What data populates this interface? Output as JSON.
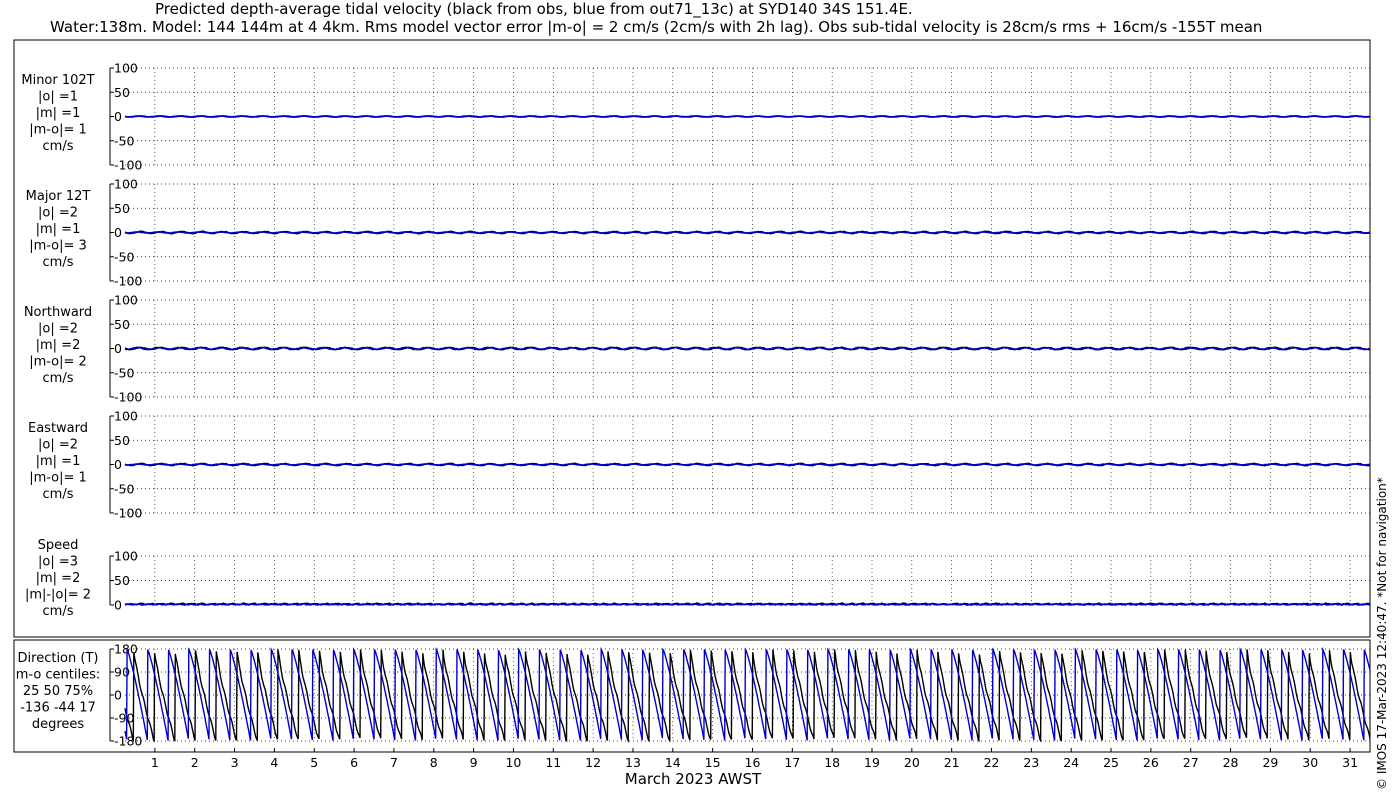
{
  "title_line1": "Predicted depth-average tidal velocity (black from obs, blue from out71_13c) at SYD140 34S 151.4E.",
  "title_line2": "Water:138m. Model: 144 144m at 4 4km. Rms model vector error |m-o| = 2 cm/s (2cm/s with 2h lag). Obs sub-tidal velocity is 28cm/s rms + 16cm/s -155T mean",
  "copyright": "© IMOS 17-Mar-2023 12:40:47. *Not for navigation*",
  "xaxis_label": "March 2023 AWST",
  "colors": {
    "obs": "#000000",
    "model": "#0000cc",
    "grid": "#000000"
  },
  "chart_data": [
    {
      "type": "line",
      "name": "minor",
      "panel_label": [
        "Minor 102T",
        "|o| =1",
        "|m| =1",
        "|m-o|= 1",
        "cm/s"
      ],
      "y_ticks": [
        "100",
        "50",
        "0",
        "-50",
        "-100"
      ],
      "ylim": [
        -100,
        100
      ],
      "series": [
        {
          "name": "obs",
          "amplitude": 1,
          "mean": 0
        },
        {
          "name": "model",
          "amplitude": 1,
          "mean": 0
        }
      ]
    },
    {
      "type": "line",
      "name": "major",
      "panel_label": [
        "Major 12T",
        "|o| =2",
        "|m| =1",
        "|m-o|= 3",
        "cm/s"
      ],
      "y_ticks": [
        "100",
        "50",
        "0",
        "-50",
        "-100"
      ],
      "ylim": [
        -100,
        100
      ],
      "series": [
        {
          "name": "obs",
          "amplitude": 2,
          "mean": 0
        },
        {
          "name": "model",
          "amplitude": 1,
          "mean": 0
        }
      ]
    },
    {
      "type": "line",
      "name": "northward",
      "panel_label": [
        "Northward",
        "|o| =2",
        "|m| =2",
        "|m-o|= 2",
        "cm/s"
      ],
      "y_ticks": [
        "100",
        "50",
        "0",
        "-50",
        "-100"
      ],
      "ylim": [
        -100,
        100
      ],
      "series": [
        {
          "name": "obs",
          "amplitude": 2,
          "mean": 0
        },
        {
          "name": "model",
          "amplitude": 2,
          "mean": 0
        }
      ]
    },
    {
      "type": "line",
      "name": "eastward",
      "panel_label": [
        "Eastward",
        "|o| =2",
        "|m| =1",
        "|m-o|= 1",
        "cm/s"
      ],
      "y_ticks": [
        "100",
        "50",
        "0",
        "-50",
        "-100"
      ],
      "ylim": [
        -100,
        100
      ],
      "series": [
        {
          "name": "obs",
          "amplitude": 2,
          "mean": 0
        },
        {
          "name": "model",
          "amplitude": 1,
          "mean": 0
        }
      ]
    },
    {
      "type": "line",
      "name": "speed",
      "panel_label": [
        "Speed",
        "|o| =3",
        "|m| =2",
        "|m|-|o|= 2",
        "cm/s"
      ],
      "y_ticks": [
        "100",
        "50",
        "0"
      ],
      "ylim": [
        0,
        100
      ],
      "series": [
        {
          "name": "obs",
          "amplitude": 3,
          "mean": 0
        },
        {
          "name": "model",
          "amplitude": 2,
          "mean": 0
        }
      ]
    },
    {
      "type": "line",
      "name": "direction",
      "panel_label": [
        "Direction (T)",
        "m-o centiles:",
        "25  50  75%",
        "-136  -44  17",
        "degrees"
      ],
      "y_ticks": [
        "180",
        "90",
        "0",
        "-90",
        "-180"
      ],
      "ylim": [
        -180,
        180
      ],
      "series": [
        {
          "name": "obs",
          "kind": "wrapped-phase"
        },
        {
          "name": "model",
          "kind": "wrapped-phase"
        }
      ]
    }
  ],
  "x_ticks": [
    "1",
    "2",
    "3",
    "4",
    "5",
    "6",
    "7",
    "8",
    "9",
    "10",
    "11",
    "12",
    "13",
    "14",
    "15",
    "16",
    "17",
    "18",
    "19",
    "20",
    "21",
    "22",
    "23",
    "24",
    "25",
    "26",
    "27",
    "28",
    "29",
    "30",
    "31"
  ],
  "xlim_days": [
    0.25,
    31.5
  ]
}
